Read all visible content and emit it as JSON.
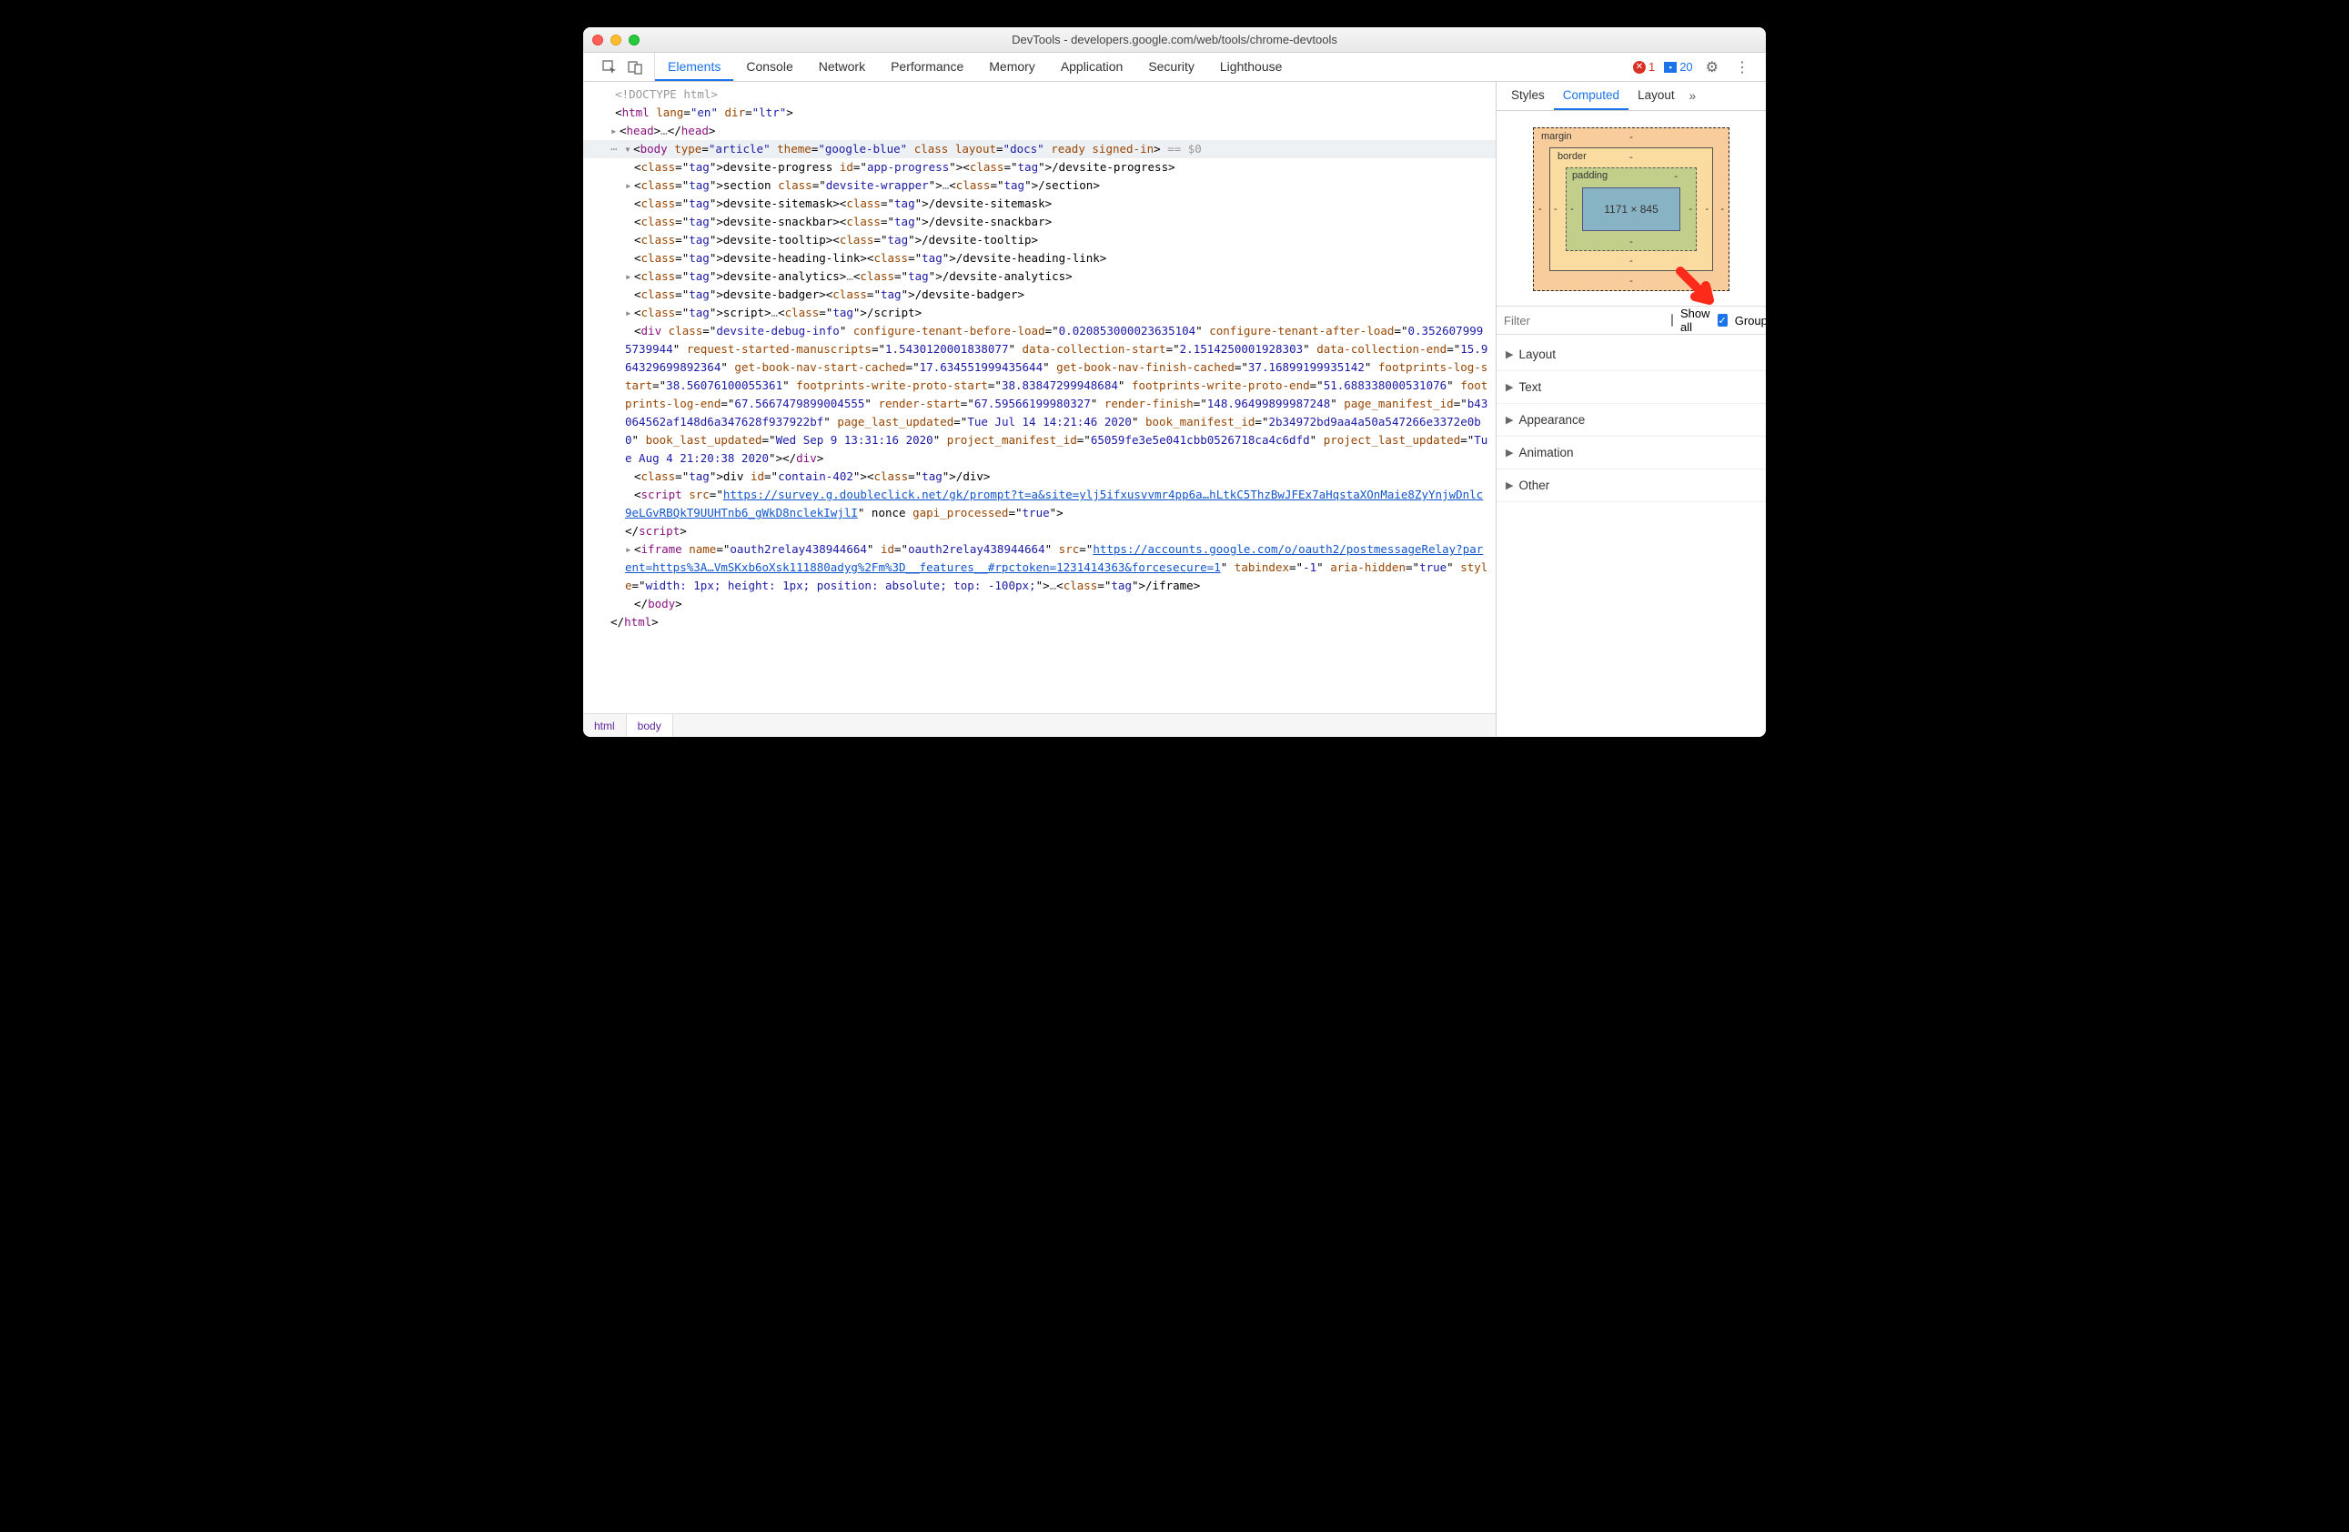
{
  "window": {
    "title": "DevTools - developers.google.com/web/tools/chrome-devtools"
  },
  "toolbar": {
    "tabs": [
      "Elements",
      "Console",
      "Network",
      "Performance",
      "Memory",
      "Application",
      "Security",
      "Lighthouse"
    ],
    "active": 0,
    "errors": "1",
    "messages": "20"
  },
  "dom": {
    "doctype": "<!DOCTYPE html>",
    "htmlOpen": {
      "tag": "html",
      "attrs": [
        [
          "lang",
          "en"
        ],
        [
          "dir",
          "ltr"
        ]
      ]
    },
    "headCollapsed": "…",
    "body": {
      "tag": "body",
      "attrs": [
        [
          "type",
          "article"
        ],
        [
          "theme",
          "google-blue"
        ],
        [
          "class",
          ""
        ],
        [
          "layout",
          "docs"
        ],
        [
          "ready",
          ""
        ],
        [
          "signed-in",
          ""
        ]
      ],
      "trailer": " == $0"
    },
    "children": [
      {
        "raw": "<devsite-progress id=\"app-progress\"></devsite-progress>"
      },
      {
        "collapsed": true,
        "raw": "<section class=\"devsite-wrapper\">…</section>"
      },
      {
        "raw": "<devsite-sitemask></devsite-sitemask>"
      },
      {
        "raw": "<devsite-snackbar></devsite-snackbar>"
      },
      {
        "raw": "<devsite-tooltip></devsite-tooltip>"
      },
      {
        "raw": "<devsite-heading-link></devsite-heading-link>"
      },
      {
        "collapsed": true,
        "raw": "<devsite-analytics>…</devsite-analytics>"
      },
      {
        "raw": "<devsite-badger></devsite-badger>"
      },
      {
        "collapsed": true,
        "raw": "<script>…</script>"
      }
    ],
    "debugDiv": {
      "open": "div",
      "attrs": [
        [
          "class",
          "devsite-debug-info"
        ],
        [
          "configure-tenant-before-load",
          "0.020853000023635104"
        ],
        [
          "configure-tenant-after-load",
          "0.3526079995739944"
        ],
        [
          "request-started-manuscripts",
          "1.5430120001838077"
        ],
        [
          "data-collection-start",
          "2.1514250001928303"
        ],
        [
          "data-collection-end",
          "15.964329699892364"
        ],
        [
          "get-book-nav-start-cached",
          "17.634551999435644"
        ],
        [
          "get-book-nav-finish-cached",
          "37.16899199935142"
        ],
        [
          "footprints-log-start",
          "38.56076100055361"
        ],
        [
          "footprints-write-proto-start",
          "38.83847299948684"
        ],
        [
          "footprints-write-proto-end",
          "51.688338000531076"
        ],
        [
          "footprints-log-end",
          "67.5667479899004555"
        ],
        [
          "render-start",
          "67.59566199980327"
        ],
        [
          "render-finish",
          "148.96499899987248"
        ],
        [
          "page_manifest_id",
          "b43064562af148d6a347628f937922bf"
        ],
        [
          "page_last_updated",
          "Tue Jul 14 14:21:46 2020"
        ],
        [
          "book_manifest_id",
          "2b34972bd9aa4a50a547266e3372e0b0"
        ],
        [
          "book_last_updated",
          "Wed Sep  9 13:31:16 2020"
        ],
        [
          "project_manifest_id",
          "65059fe3e5e041cbb0526718ca4c6dfd"
        ],
        [
          "project_last_updated",
          "Tue Aug  4 21:20:38 2020"
        ]
      ]
    },
    "containDiv": {
      "raw": "<div id=\"contain-402\"></div>"
    },
    "surveyScript": {
      "srcUrl": "https://survey.g.doubleclick.net/gk/prompt?t=a&site=ylj5ifxusvvmr4pp6a…hLtkC5ThzBwJFEx7aHqstaXOnMaie8ZyYnjwDnlc9eLGvRBQkT9UUHTnb6_gWkD8nclekIwjlI",
      "tail": " nonce gapi_processed=\"true\">"
    },
    "iframe": {
      "nameId": "oauth2relay438944664",
      "srcUrl": "https://accounts.google.com/o/oauth2/postmessageRelay?parent=https%3A…VmSKxb6oXsk111880adyg%2Fm%3D__features__#rpctoken=1231414363&forcesecure=1",
      "tail": " tabindex=\"-1\" aria-hidden=\"true\" style=\"width: 1px; height: 1px; position: absolute; top: -100px;\">…</iframe>"
    },
    "bodyClose": "</body>",
    "htmlClose": "</html>"
  },
  "breadcrumb": [
    "html",
    "body"
  ],
  "side": {
    "tabs": [
      "Styles",
      "Computed",
      "Layout"
    ],
    "active": 1,
    "boxModel": {
      "margin": "margin",
      "border": "border",
      "padding": "padding",
      "content": "1171 × 845"
    },
    "filterPlaceholder": "Filter",
    "showAll": "Show all",
    "group": "Group",
    "showAllChecked": false,
    "groupChecked": true,
    "groups": [
      "Layout",
      "Text",
      "Appearance",
      "Animation",
      "Other"
    ]
  }
}
